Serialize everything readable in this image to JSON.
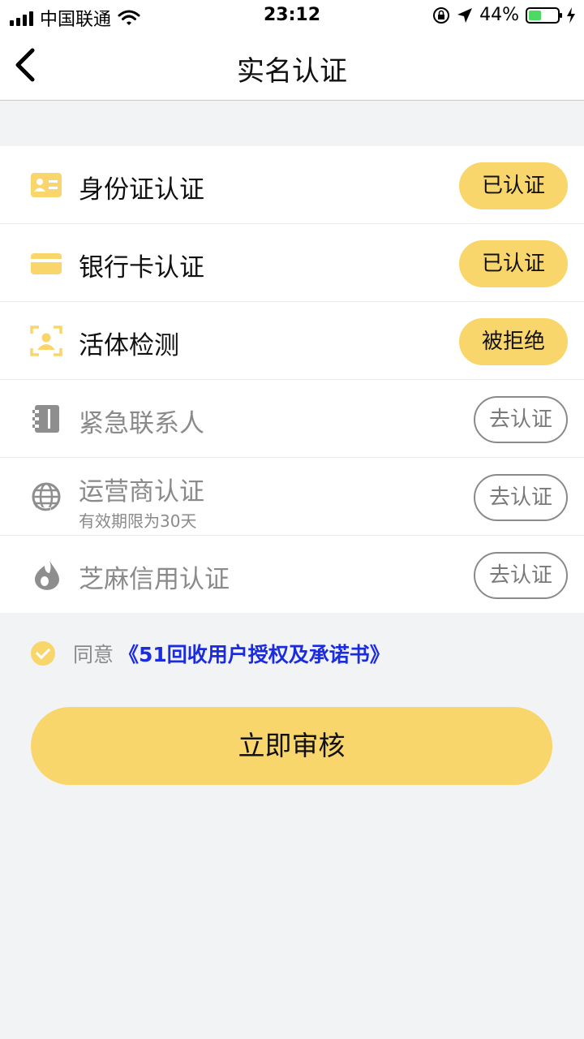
{
  "status_bar": {
    "carrier": "中国联通",
    "time": "23:12",
    "battery_percent": "44%",
    "battery_level": 0.44
  },
  "nav": {
    "title": "实名认证",
    "back_icon": "chevron-left-icon"
  },
  "items": [
    {
      "label": "身份证认证",
      "sub": "",
      "action": "已认证",
      "icon": "id-card-icon",
      "state": "done"
    },
    {
      "label": "银行卡认证",
      "sub": "",
      "action": "已认证",
      "icon": "bank-card-icon",
      "state": "done"
    },
    {
      "label": "活体检测",
      "sub": "",
      "action": "被拒绝",
      "icon": "face-scan-icon",
      "state": "done"
    },
    {
      "label": "紧急联系人",
      "sub": "",
      "action": "去认证",
      "icon": "contacts-book-icon",
      "state": "todo"
    },
    {
      "label": "运营商认证",
      "sub": "有效期限为30天",
      "action": "去认证",
      "icon": "globe-refresh-icon",
      "state": "todo"
    },
    {
      "label": "芝麻信用认证",
      "sub": "",
      "action": "去认证",
      "icon": "sesame-drop-icon",
      "state": "todo"
    }
  ],
  "agreement": {
    "prefix": "同意",
    "link": "《51回收用户授权及承诺书》",
    "checked": true
  },
  "submit_label": "立即审核",
  "colors": {
    "accent": "#f8d66c",
    "link": "#1a2be0",
    "muted": "#8a8a8a",
    "background": "#f2f3f5"
  }
}
